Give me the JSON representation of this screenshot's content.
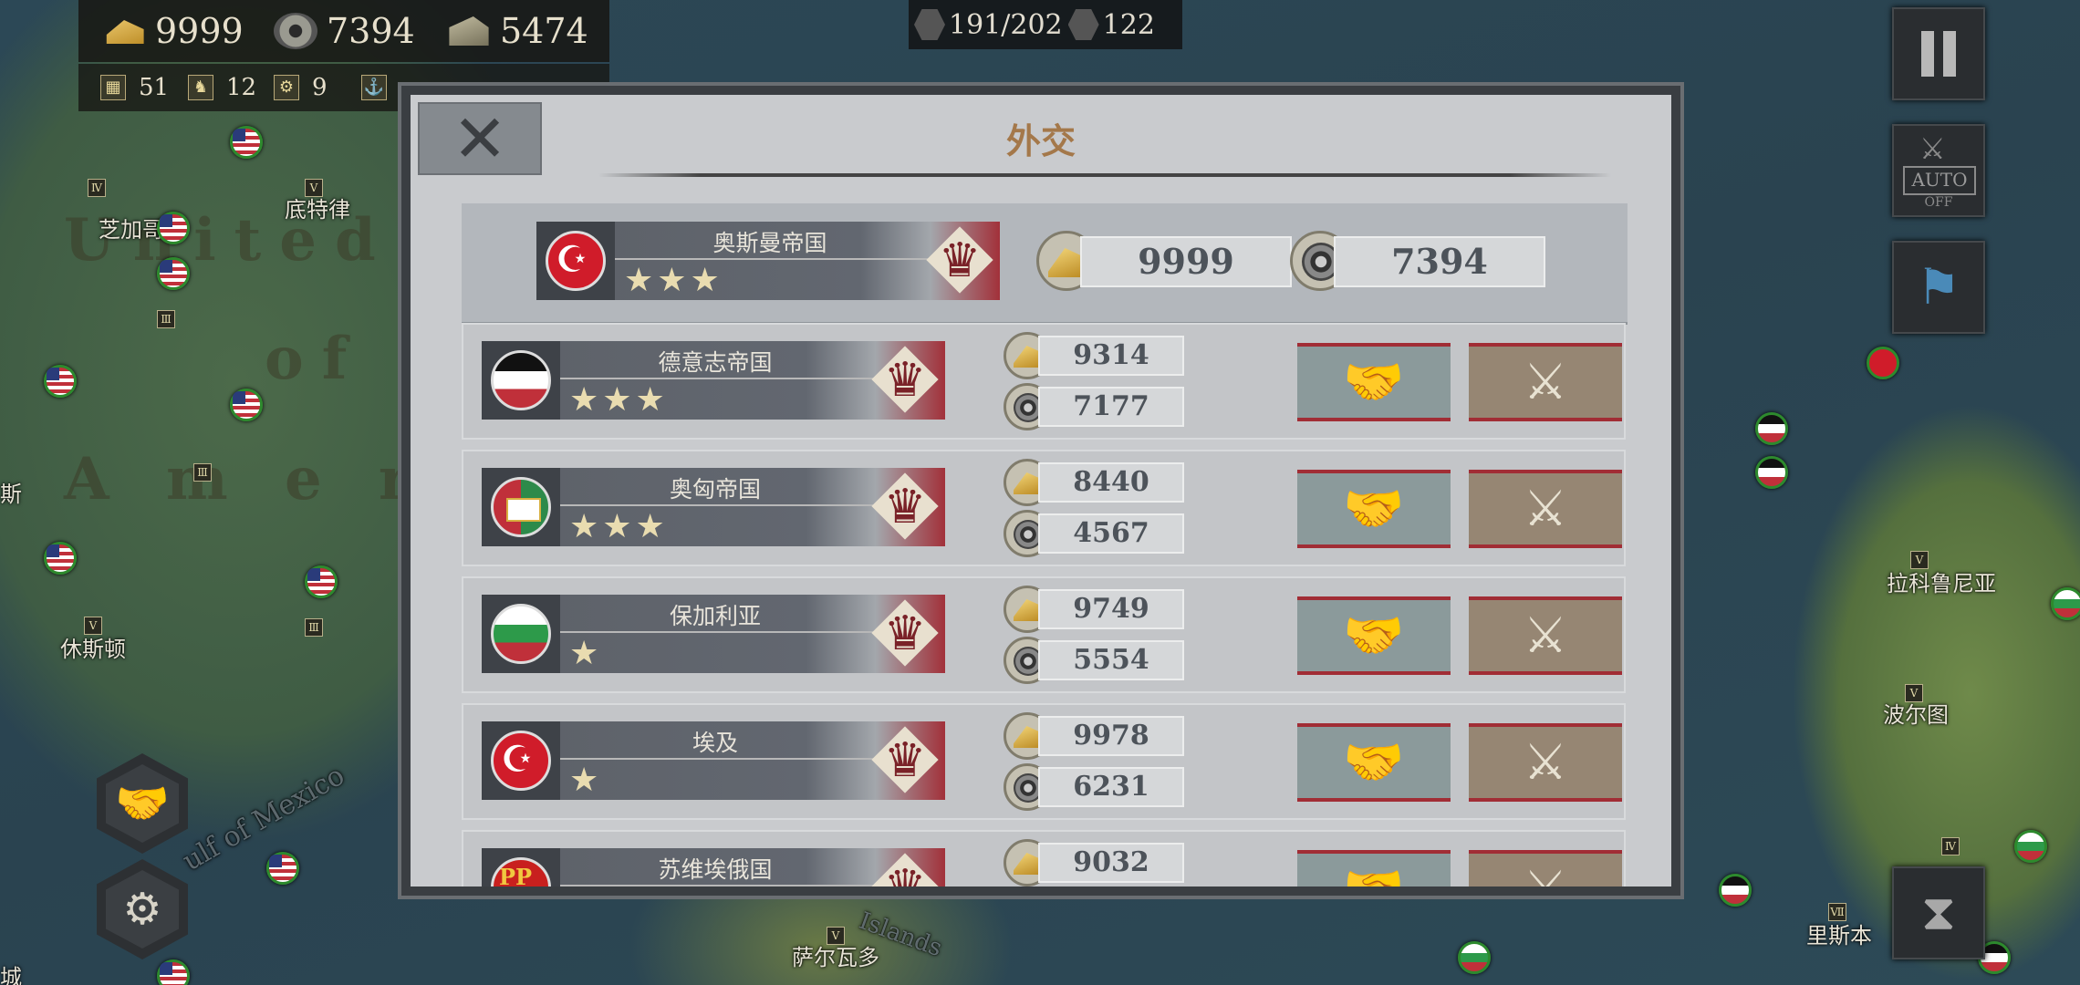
{
  "resources": {
    "gold": "9999",
    "industry": "7394",
    "material": "5474"
  },
  "small_resources": [
    "51",
    "12",
    "9"
  ],
  "population": {
    "value": "191/202",
    "turns": "122"
  },
  "map_labels": {
    "chicago": "芝加哥",
    "detroit": "底特律",
    "houston": "休斯顿",
    "labrador": "拉科鲁尼亚",
    "porto": "波尔图",
    "lisbon": "里斯本",
    "salvador": "萨尔瓦多",
    "si": "斯",
    "city": "城",
    "united_states": "United S",
    "of": "of",
    "amer": "A m e r",
    "gulf": "ulf of Mexico",
    "islands": "Islands"
  },
  "auto_button": {
    "label": "AUTO",
    "state": "OFF"
  },
  "modal": {
    "title": "外交",
    "close_symbol": "✕",
    "player": {
      "name": "奥斯曼帝国",
      "stars": "★★★",
      "gold": "9999",
      "industry": "7394"
    },
    "nations": [
      {
        "name": "德意志帝国",
        "stars": "★★★",
        "gold": "9314",
        "industry": "7177"
      },
      {
        "name": "奥匈帝国",
        "stars": "★★★",
        "gold": "8440",
        "industry": "4567"
      },
      {
        "name": "保加利亚",
        "stars": "★",
        "gold": "9749",
        "industry": "5554"
      },
      {
        "name": "埃及",
        "stars": "★",
        "gold": "9978",
        "industry": "6231"
      },
      {
        "name": "苏维埃俄国",
        "stars": "",
        "gold": "9032",
        "industry": ""
      }
    ]
  },
  "icons": {
    "peace": "handshake-icon",
    "war": "crossed-swords-icon",
    "crown": "crown-icon"
  },
  "colors": {
    "title": "#a4784a",
    "action_border": "#a12d35"
  }
}
